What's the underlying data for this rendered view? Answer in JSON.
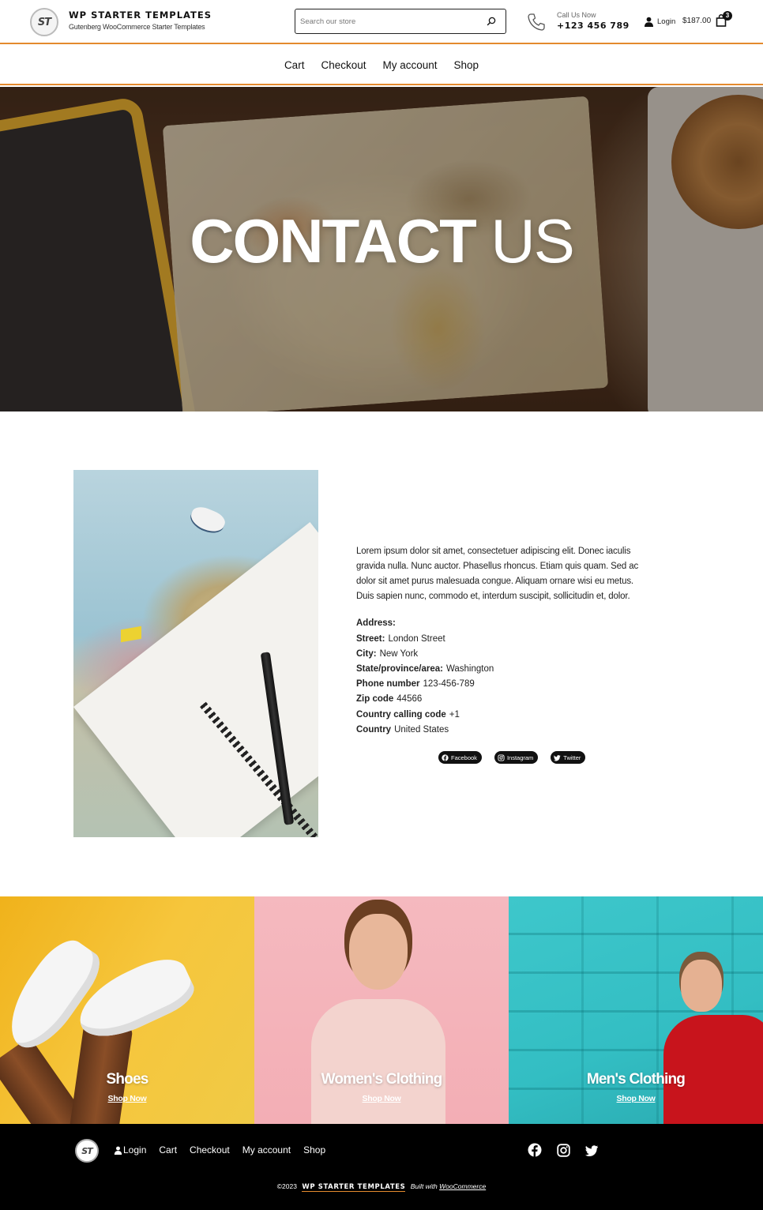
{
  "header": {
    "logo_text": "ST",
    "brand_title": "WP STARTER TEMPLATES",
    "brand_subtitle": "Gutenberg WooCommerce Starter Templates",
    "search_placeholder": "Search our store",
    "call_label": "Call Us Now",
    "call_number": "+123 456 789",
    "login_label": "Login",
    "cart_total": "$187.00",
    "cart_count": "3"
  },
  "nav": {
    "items": [
      {
        "label": "Cart"
      },
      {
        "label": "Checkout"
      },
      {
        "label": "My account"
      },
      {
        "label": "Shop"
      }
    ]
  },
  "hero": {
    "title_bold": "CONTACT",
    "title_light": "US"
  },
  "contact": {
    "intro": "Lorem ipsum dolor sit amet, consectetuer adipiscing elit. Donec iaculis gravida nulla. Nunc auctor. Phasellus rhoncus. Etiam quis quam. Sed ac dolor sit amet purus malesuada congue. Aliquam ornare wisi eu metus. Duis sapien nunc, commodo et, interdum suscipit, sollicitudin et, dolor.",
    "address_heading": "Address:",
    "fields": [
      {
        "label": "Street:",
        "value": "London Street"
      },
      {
        "label": "City:",
        "value": "New York"
      },
      {
        "label": "State/province/area:",
        "value": "Washington"
      },
      {
        "label": "Phone number",
        "value": "123-456-789"
      },
      {
        "label": "Zip code",
        "value": "44566"
      },
      {
        "label": "Country calling code",
        "value": "+1"
      },
      {
        "label": "Country",
        "value": "United States"
      }
    ],
    "socials": [
      {
        "label": "Facebook",
        "icon": "facebook-icon"
      },
      {
        "label": "Instagram",
        "icon": "instagram-icon"
      },
      {
        "label": "Twitter",
        "icon": "twitter-icon"
      }
    ]
  },
  "categories": [
    {
      "name": "Shoes",
      "cta": "Shop Now"
    },
    {
      "name": "Women's Clothing",
      "cta": "Shop Now"
    },
    {
      "name": "Men's Clothing",
      "cta": "Shop Now"
    }
  ],
  "footer": {
    "logo_text": "ST",
    "nav": [
      {
        "label": "Login"
      },
      {
        "label": "Cart"
      },
      {
        "label": "Checkout"
      },
      {
        "label": "My account"
      },
      {
        "label": "Shop"
      }
    ],
    "copyright": "©2023",
    "brand": "WP STARTER TEMPLATES",
    "built_with": "Built with",
    "built_link": "WooCommerce"
  },
  "colors": {
    "accent": "#e48a2e",
    "footer_bg": "#000000",
    "shoes_bg": "#f3be2e",
    "women_bg": "#f4b4ba",
    "men_bg": "#38c2c6",
    "pill_bg": "#111111"
  }
}
